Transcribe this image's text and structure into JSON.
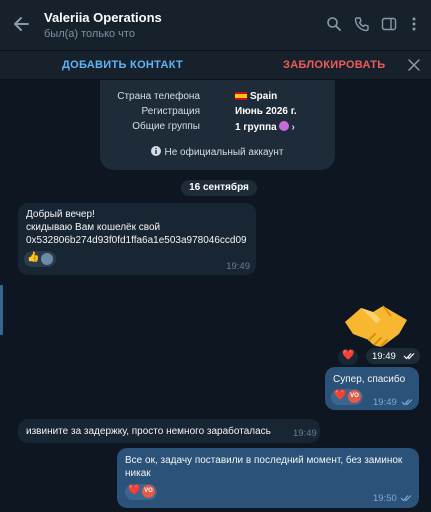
{
  "header": {
    "title": "Valeriia Operations",
    "status": "был(а) только что"
  },
  "action_bar": {
    "add_contact": "ДОБАВИТЬ КОНТАКТ",
    "block": "ЗАБЛОКИРОВАТЬ"
  },
  "info_card": {
    "phone_country_label": "Страна телефона",
    "phone_country_value": "Spain",
    "registration_label": "Регистрация",
    "registration_value": "Июнь 2026 г.",
    "groups_label": "Общие группы",
    "groups_value": "1 группа",
    "unofficial": "Не официальный аккаунт"
  },
  "date_separator": "16 сентября",
  "messages": [
    {
      "dir": "in",
      "lines": [
        "Добрый вечер!",
        "скидываю Вам кошелёк свой",
        "0x532806b274d93f0fd1ffa6a1e503a978046ccd09"
      ],
      "time": "19:49",
      "reactions": [
        "👍"
      ]
    },
    {
      "dir": "out",
      "sticker": "handshake",
      "time": "19:49",
      "reactions": [
        "❤️"
      ]
    },
    {
      "dir": "out",
      "lines": [
        "Супер, спасибо"
      ],
      "time": "19:49",
      "reactions": [
        "❤️",
        "VO"
      ]
    },
    {
      "dir": "in",
      "lines": [
        "извините за задержку, просто немного заработалась"
      ],
      "time": "19:49"
    },
    {
      "dir": "out",
      "lines": [
        "Все ок, задачу поставили в последний момент, без заминок",
        "никак"
      ],
      "time": "19:50",
      "reactions": [
        "❤️",
        "VO"
      ]
    }
  ],
  "avatar_initials": "VO",
  "colors": {
    "chat_bg": "#0e1621",
    "header_bg": "#17212b",
    "incoming": "#182533",
    "outgoing": "#2b5278",
    "accent": "#5eb5f7",
    "danger": "#ef5b5b"
  }
}
